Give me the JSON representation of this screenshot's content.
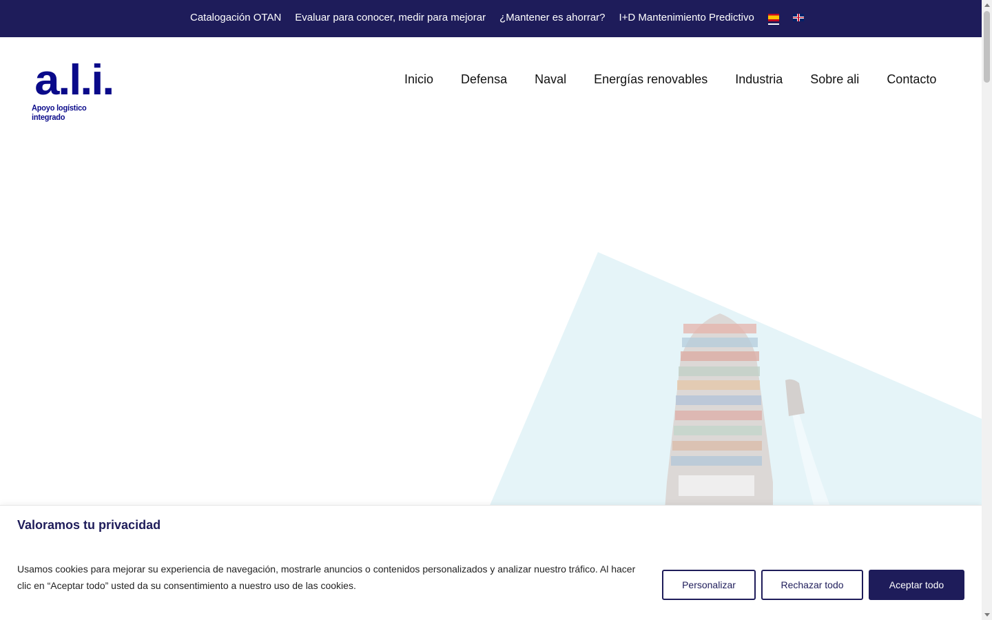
{
  "topbar": {
    "links": [
      "Catalogación OTAN",
      "Evaluar para conocer, medir para mejorar",
      "¿Mantener es ahorrar?",
      "I+D Mantenimiento Predictivo"
    ],
    "languages": [
      "es",
      "en"
    ]
  },
  "logo": {
    "mark": "a.l.i.",
    "subtitle": "Apoyo logístico integrado"
  },
  "nav": {
    "items": [
      "Inicio",
      "Defensa",
      "Naval",
      "Energías renovables",
      "Industria",
      "Sobre ali",
      "Contacto"
    ]
  },
  "cookie_banner": {
    "title": "Valoramos tu privacidad",
    "text": "Usamos cookies para mejorar su experiencia de navegación, mostrarle anuncios o contenidos personalizados y analizar nuestro tráfico. Al hacer clic en “Aceptar todo” usted da su consentimiento a nuestro uso de las cookies.",
    "customize_label": "Personalizar",
    "reject_label": "Rechazar todo",
    "accept_label": "Aceptar todo"
  },
  "colors": {
    "brand": "#1e1c5a",
    "logo": "#0a0a8a",
    "hero_tint": "#d6eef5"
  }
}
